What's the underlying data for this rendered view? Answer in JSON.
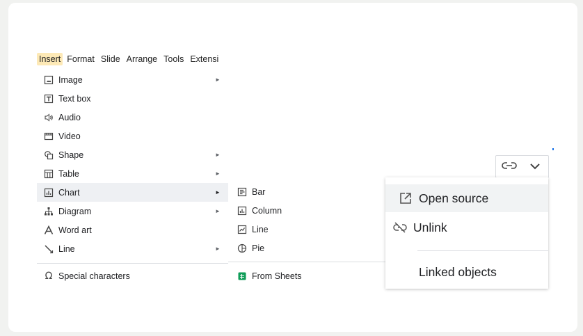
{
  "menubar": {
    "items": [
      {
        "label": "Insert",
        "active": true
      },
      {
        "label": "Format"
      },
      {
        "label": "Slide"
      },
      {
        "label": "Arrange"
      },
      {
        "label": "Tools"
      },
      {
        "label": "Extensions"
      }
    ]
  },
  "insert_menu": {
    "items": [
      {
        "label": "Image",
        "icon": "image-icon",
        "submenu": true
      },
      {
        "label": "Text box",
        "icon": "text-box-icon"
      },
      {
        "label": "Audio",
        "icon": "audio-icon"
      },
      {
        "label": "Video",
        "icon": "video-icon"
      },
      {
        "label": "Shape",
        "icon": "shape-icon",
        "submenu": true
      },
      {
        "label": "Table",
        "icon": "table-icon",
        "submenu": true
      },
      {
        "label": "Chart",
        "icon": "chart-icon",
        "submenu": true,
        "highlighted": true
      },
      {
        "label": "Diagram",
        "icon": "diagram-icon",
        "submenu": true
      },
      {
        "label": "Word art",
        "icon": "word-art-icon"
      },
      {
        "label": "Line",
        "icon": "line-icon",
        "submenu": true
      },
      {
        "label": "Special characters",
        "icon": "omega-icon"
      }
    ],
    "submenu_arrow": "►"
  },
  "chart_submenu": {
    "items": [
      {
        "label": "Bar",
        "icon": "bar-chart-icon"
      },
      {
        "label": "Column",
        "icon": "column-chart-icon"
      },
      {
        "label": "Line",
        "icon": "line-chart-icon"
      },
      {
        "label": "Pie",
        "icon": "pie-chart-icon"
      },
      {
        "label": "From Sheets",
        "icon": "sheets-icon"
      }
    ]
  },
  "link_menu": {
    "items": [
      {
        "label": "Open source",
        "icon": "open-external-icon"
      },
      {
        "label": "Unlink",
        "icon": "unlink-icon"
      },
      {
        "label": "Linked objects"
      }
    ]
  },
  "colors": {
    "active_menu": "#fde9b6",
    "hover": "#eef0f3",
    "sheets_green": "#0f9d58",
    "accent_blue": "#1a73e8"
  }
}
